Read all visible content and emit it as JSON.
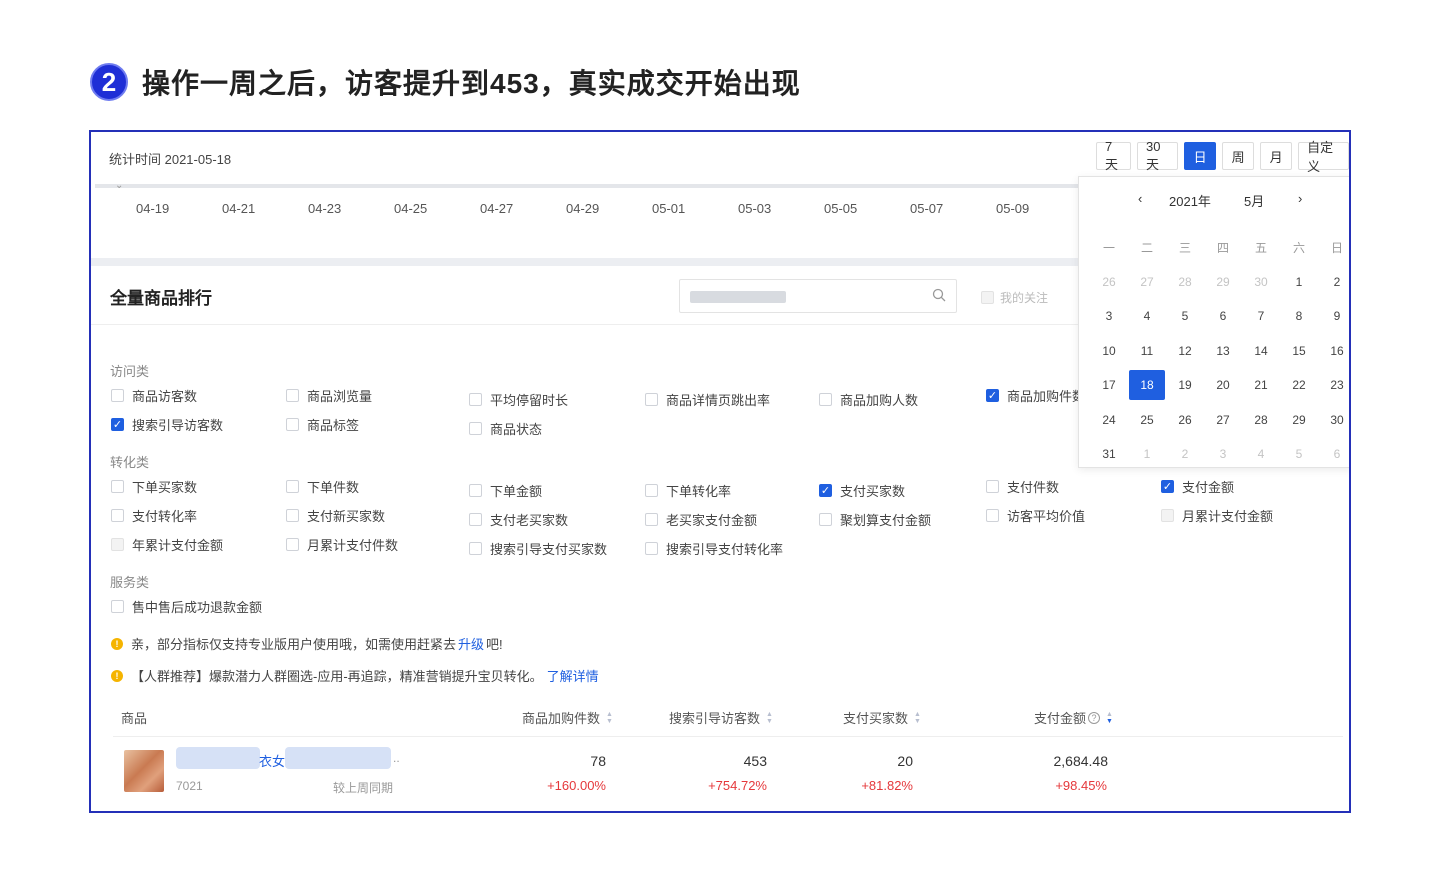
{
  "heading": {
    "step": "2",
    "text": "操作一周之后，访客提升到453，真实成交开始出现"
  },
  "stat_time": "统计时间 2021-05-18",
  "range_buttons": [
    "7天",
    "30天",
    "日",
    "周",
    "月",
    "自定义"
  ],
  "axis_labels": [
    "04-19",
    "04-21",
    "04-23",
    "04-25",
    "04-27",
    "04-29",
    "05-01",
    "05-03",
    "05-05",
    "05-07",
    "05-09"
  ],
  "section_title": "全量商品排行",
  "follow_label": "我的关注",
  "categories": {
    "visit": "访问类",
    "convert": "转化类",
    "service": "服务类"
  },
  "metrics": {
    "visit_r1": [
      "商品访客数",
      "商品浏览量",
      "平均停留时长",
      "商品详情页跳出率",
      "商品加购人数",
      "商品加购件数"
    ],
    "visit_r2": [
      "搜索引导访客数",
      "商品标签",
      "商品状态"
    ],
    "conv_r1": [
      "下单买家数",
      "下单件数",
      "下单金额",
      "下单转化率",
      "支付买家数",
      "支付件数",
      "支付金额"
    ],
    "conv_r2": [
      "支付转化率",
      "支付新买家数",
      "支付老买家数",
      "老买家支付金额",
      "聚划算支付金额",
      "访客平均价值",
      "月累计支付金额"
    ],
    "conv_r3": [
      "年累计支付金额",
      "月累计支付件数",
      "搜索引导支付买家数",
      "搜索引导支付转化率"
    ],
    "service_r1": [
      "售中售后成功退款金额"
    ]
  },
  "tips": {
    "tip1_pre": "亲，部分指标仅支持专业版用户使用哦，如需使用赶紧去",
    "tip1_link": "升级",
    "tip1_post": "吧!",
    "tip2_pre": "【人群推荐】爆款潜力人群圈选-应用-再追踪，精准营销提升宝贝转化。",
    "tip2_link": "了解详情"
  },
  "table": {
    "headers": [
      "商品",
      "商品加购件数",
      "搜索引导访客数",
      "支付买家数",
      "支付金额"
    ],
    "row": {
      "name_fragment": "衣女",
      "ellipsis": "..",
      "id": "7021",
      "compare_label": "较上周同期",
      "values": [
        "78",
        "453",
        "20",
        "2,684.48"
      ],
      "changes": [
        "+160.00%",
        "+754.72%",
        "+81.82%",
        "+98.45%"
      ]
    }
  },
  "calendar": {
    "year": "2021年",
    "month": "5月",
    "weekdays": [
      "一",
      "二",
      "三",
      "四",
      "五",
      "六",
      "日"
    ],
    "days": [
      "26",
      "27",
      "28",
      "29",
      "30",
      "1",
      "2",
      "3",
      "4",
      "5",
      "6",
      "7",
      "8",
      "9",
      "10",
      "11",
      "12",
      "13",
      "14",
      "15",
      "16",
      "17",
      "18",
      "19",
      "20",
      "21",
      "22",
      "23",
      "24",
      "25",
      "26",
      "27",
      "28",
      "29",
      "30",
      "31",
      "1",
      "2",
      "3",
      "4",
      "5",
      "6"
    ],
    "selected": "18"
  },
  "colors": {
    "accent": "#1f5fe0",
    "heading_badge": "#1f2fd6",
    "frame_border": "#2430b8",
    "negative_change": "#e5383b",
    "tip": "#f5b400"
  }
}
